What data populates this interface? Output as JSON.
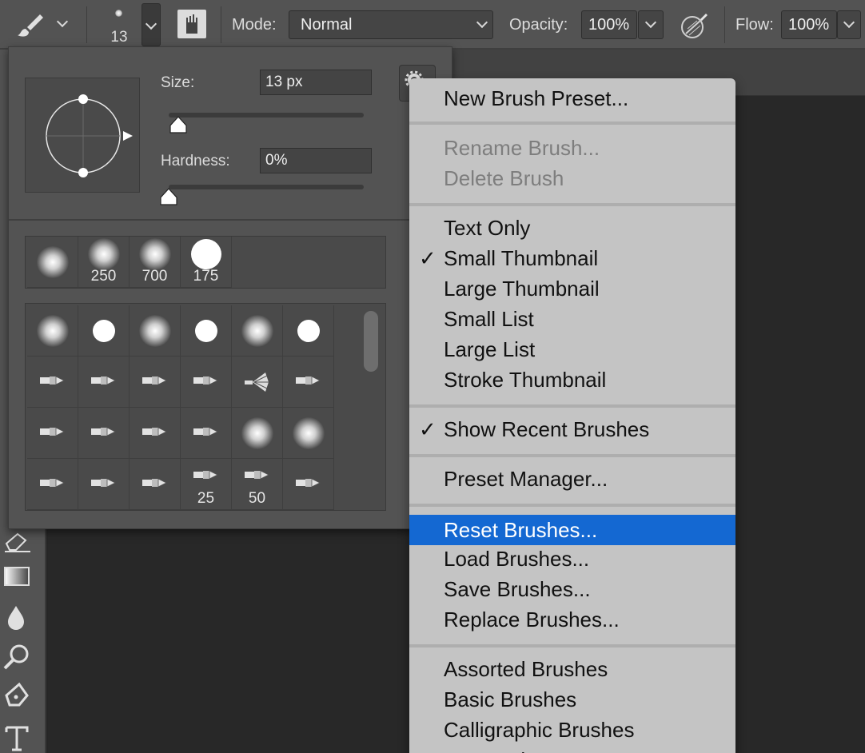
{
  "options_bar": {
    "brush_size": "13",
    "mode_label": "Mode:",
    "mode_value": "Normal",
    "opacity_label": "Opacity:",
    "opacity_value": "100%",
    "flow_label": "Flow:",
    "flow_value": "100%"
  },
  "brush_panel": {
    "size_label": "Size:",
    "size_value": "13 px",
    "hardness_label": "Hardness:",
    "hardness_value": "0%",
    "size_slider_fraction": 0.05,
    "hardness_slider_fraction": 0.0,
    "recent": [
      {
        "kind": "soft",
        "label": ""
      },
      {
        "kind": "soft",
        "label": "250"
      },
      {
        "kind": "soft",
        "label": "700"
      },
      {
        "kind": "hard",
        "label": "175"
      }
    ],
    "grid": [
      [
        {
          "kind": "soft",
          "label": ""
        },
        {
          "kind": "hard",
          "label": ""
        },
        {
          "kind": "soft",
          "label": ""
        },
        {
          "kind": "hard",
          "label": ""
        },
        {
          "kind": "soft",
          "label": ""
        },
        {
          "kind": "hard",
          "label": ""
        }
      ],
      [
        {
          "kind": "tip",
          "label": ""
        },
        {
          "kind": "tip",
          "label": ""
        },
        {
          "kind": "tip",
          "label": ""
        },
        {
          "kind": "tip",
          "label": ""
        },
        {
          "kind": "fan",
          "label": ""
        },
        {
          "kind": "tip",
          "label": ""
        }
      ],
      [
        {
          "kind": "tip",
          "label": ""
        },
        {
          "kind": "tip",
          "label": ""
        },
        {
          "kind": "tip",
          "label": ""
        },
        {
          "kind": "tip",
          "label": ""
        },
        {
          "kind": "soft",
          "label": ""
        },
        {
          "kind": "soft",
          "label": ""
        }
      ],
      [
        {
          "kind": "tip",
          "label": ""
        },
        {
          "kind": "tip",
          "label": ""
        },
        {
          "kind": "tip",
          "label": ""
        },
        {
          "kind": "tip",
          "label": "25"
        },
        {
          "kind": "tip",
          "label": "50"
        },
        {
          "kind": "tip",
          "label": ""
        }
      ]
    ]
  },
  "menu": {
    "new_brush_preset": "New Brush Preset...",
    "rename_brush": "Rename Brush...",
    "delete_brush": "Delete Brush",
    "text_only": "Text Only",
    "small_thumbnail": "Small Thumbnail",
    "large_thumbnail": "Large Thumbnail",
    "small_list": "Small List",
    "large_list": "Large List",
    "stroke_thumbnail": "Stroke Thumbnail",
    "show_recent_brushes": "Show Recent Brushes",
    "preset_manager": "Preset Manager...",
    "reset_brushes": "Reset Brushes...",
    "load_brushes": "Load Brushes...",
    "save_brushes": "Save Brushes...",
    "replace_brushes": "Replace Brushes...",
    "assorted_brushes": "Assorted Brushes",
    "basic_brushes": "Basic Brushes",
    "calligraphic_brushes": "Calligraphic Brushes",
    "db_brushes": "DP Brushes",
    "checkmark": "✓"
  },
  "colors": {
    "menu_highlight": "#1468d2",
    "panel_bg": "#535353"
  }
}
